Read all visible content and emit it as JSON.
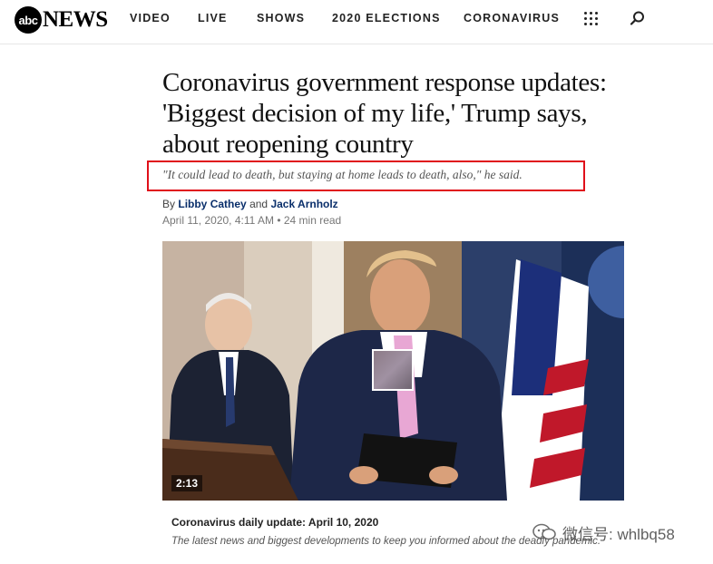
{
  "header": {
    "logo": {
      "abc": "abc",
      "news": "NEWS"
    },
    "nav": [
      "VIDEO",
      "LIVE",
      "SHOWS",
      "2020 ELECTIONS",
      "CORONAVIRUS"
    ],
    "icons": [
      "grid-menu-icon",
      "search-icon"
    ]
  },
  "article": {
    "headline": "Coronavirus government response updates: 'Biggest decision of my life,' Trump says, about reopening country",
    "subhead": "\"It could lead to death, but staying at home leads to death, also,\" he said.",
    "byline": {
      "prefix": "By",
      "author1": "Libby Cathey",
      "joiner": "and",
      "author2": "Jack Arnholz"
    },
    "date": "April 11, 2020, 4:11 AM",
    "separator": "•",
    "read_time": "24 min read"
  },
  "video": {
    "duration": "2:13",
    "caption_title": "Coronavirus daily update: April 10, 2020",
    "caption_desc": "The latest news and biggest developments to keep you informed about the deadly pandemic."
  },
  "watermark": {
    "text": "微信号: whlbq58"
  },
  "colors": {
    "highlight_box": "#e0101a",
    "author_link": "#0a2f6b"
  }
}
